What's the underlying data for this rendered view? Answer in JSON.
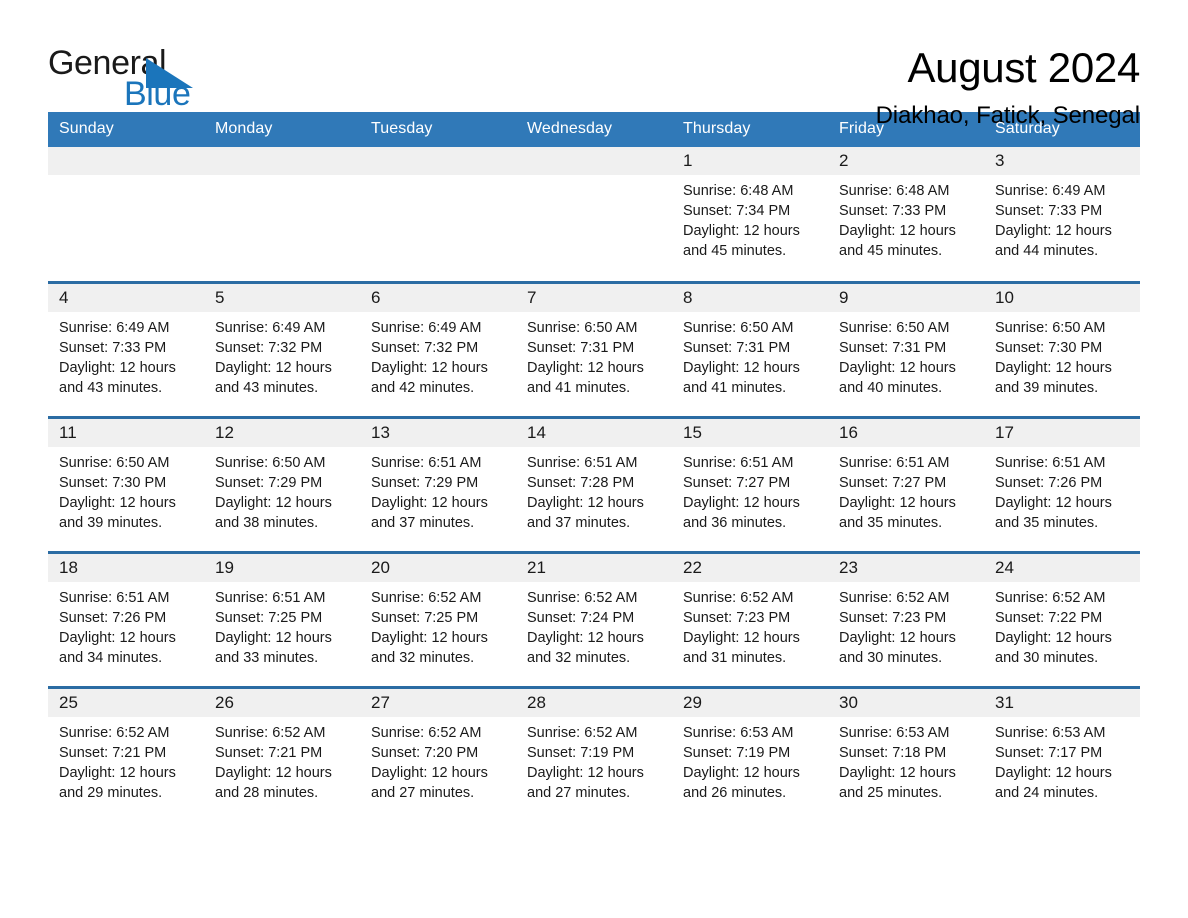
{
  "brand": {
    "name_part1": "General",
    "name_part2": "Blue",
    "triangle_icon": "triangle-icon",
    "accent_color": "#1b75bb"
  },
  "header": {
    "month_title": "August 2024",
    "location": "Diakhao, Fatick, Senegal",
    "header_bg_color": "#3079b8",
    "row_divider_color": "#2b6ca3",
    "daynum_bg_color": "#f0f0f0"
  },
  "weekday_headers": [
    "Sunday",
    "Monday",
    "Tuesday",
    "Wednesday",
    "Thursday",
    "Friday",
    "Saturday"
  ],
  "labels": {
    "sunrise": "Sunrise:",
    "sunset": "Sunset:",
    "daylight": "Daylight:"
  },
  "weeks": [
    [
      {
        "day": "",
        "empty": true
      },
      {
        "day": "",
        "empty": true
      },
      {
        "day": "",
        "empty": true
      },
      {
        "day": "",
        "empty": true
      },
      {
        "day": "1",
        "sunrise": "Sunrise: 6:48 AM",
        "sunset": "Sunset: 7:34 PM",
        "daylight": "Daylight: 12 hours and 45 minutes."
      },
      {
        "day": "2",
        "sunrise": "Sunrise: 6:48 AM",
        "sunset": "Sunset: 7:33 PM",
        "daylight": "Daylight: 12 hours and 45 minutes."
      },
      {
        "day": "3",
        "sunrise": "Sunrise: 6:49 AM",
        "sunset": "Sunset: 7:33 PM",
        "daylight": "Daylight: 12 hours and 44 minutes."
      }
    ],
    [
      {
        "day": "4",
        "sunrise": "Sunrise: 6:49 AM",
        "sunset": "Sunset: 7:33 PM",
        "daylight": "Daylight: 12 hours and 43 minutes."
      },
      {
        "day": "5",
        "sunrise": "Sunrise: 6:49 AM",
        "sunset": "Sunset: 7:32 PM",
        "daylight": "Daylight: 12 hours and 43 minutes."
      },
      {
        "day": "6",
        "sunrise": "Sunrise: 6:49 AM",
        "sunset": "Sunset: 7:32 PM",
        "daylight": "Daylight: 12 hours and 42 minutes."
      },
      {
        "day": "7",
        "sunrise": "Sunrise: 6:50 AM",
        "sunset": "Sunset: 7:31 PM",
        "daylight": "Daylight: 12 hours and 41 minutes."
      },
      {
        "day": "8",
        "sunrise": "Sunrise: 6:50 AM",
        "sunset": "Sunset: 7:31 PM",
        "daylight": "Daylight: 12 hours and 41 minutes."
      },
      {
        "day": "9",
        "sunrise": "Sunrise: 6:50 AM",
        "sunset": "Sunset: 7:31 PM",
        "daylight": "Daylight: 12 hours and 40 minutes."
      },
      {
        "day": "10",
        "sunrise": "Sunrise: 6:50 AM",
        "sunset": "Sunset: 7:30 PM",
        "daylight": "Daylight: 12 hours and 39 minutes."
      }
    ],
    [
      {
        "day": "11",
        "sunrise": "Sunrise: 6:50 AM",
        "sunset": "Sunset: 7:30 PM",
        "daylight": "Daylight: 12 hours and 39 minutes."
      },
      {
        "day": "12",
        "sunrise": "Sunrise: 6:50 AM",
        "sunset": "Sunset: 7:29 PM",
        "daylight": "Daylight: 12 hours and 38 minutes."
      },
      {
        "day": "13",
        "sunrise": "Sunrise: 6:51 AM",
        "sunset": "Sunset: 7:29 PM",
        "daylight": "Daylight: 12 hours and 37 minutes."
      },
      {
        "day": "14",
        "sunrise": "Sunrise: 6:51 AM",
        "sunset": "Sunset: 7:28 PM",
        "daylight": "Daylight: 12 hours and 37 minutes."
      },
      {
        "day": "15",
        "sunrise": "Sunrise: 6:51 AM",
        "sunset": "Sunset: 7:27 PM",
        "daylight": "Daylight: 12 hours and 36 minutes."
      },
      {
        "day": "16",
        "sunrise": "Sunrise: 6:51 AM",
        "sunset": "Sunset: 7:27 PM",
        "daylight": "Daylight: 12 hours and 35 minutes."
      },
      {
        "day": "17",
        "sunrise": "Sunrise: 6:51 AM",
        "sunset": "Sunset: 7:26 PM",
        "daylight": "Daylight: 12 hours and 35 minutes."
      }
    ],
    [
      {
        "day": "18",
        "sunrise": "Sunrise: 6:51 AM",
        "sunset": "Sunset: 7:26 PM",
        "daylight": "Daylight: 12 hours and 34 minutes."
      },
      {
        "day": "19",
        "sunrise": "Sunrise: 6:51 AM",
        "sunset": "Sunset: 7:25 PM",
        "daylight": "Daylight: 12 hours and 33 minutes."
      },
      {
        "day": "20",
        "sunrise": "Sunrise: 6:52 AM",
        "sunset": "Sunset: 7:25 PM",
        "daylight": "Daylight: 12 hours and 32 minutes."
      },
      {
        "day": "21",
        "sunrise": "Sunrise: 6:52 AM",
        "sunset": "Sunset: 7:24 PM",
        "daylight": "Daylight: 12 hours and 32 minutes."
      },
      {
        "day": "22",
        "sunrise": "Sunrise: 6:52 AM",
        "sunset": "Sunset: 7:23 PM",
        "daylight": "Daylight: 12 hours and 31 minutes."
      },
      {
        "day": "23",
        "sunrise": "Sunrise: 6:52 AM",
        "sunset": "Sunset: 7:23 PM",
        "daylight": "Daylight: 12 hours and 30 minutes."
      },
      {
        "day": "24",
        "sunrise": "Sunrise: 6:52 AM",
        "sunset": "Sunset: 7:22 PM",
        "daylight": "Daylight: 12 hours and 30 minutes."
      }
    ],
    [
      {
        "day": "25",
        "sunrise": "Sunrise: 6:52 AM",
        "sunset": "Sunset: 7:21 PM",
        "daylight": "Daylight: 12 hours and 29 minutes."
      },
      {
        "day": "26",
        "sunrise": "Sunrise: 6:52 AM",
        "sunset": "Sunset: 7:21 PM",
        "daylight": "Daylight: 12 hours and 28 minutes."
      },
      {
        "day": "27",
        "sunrise": "Sunrise: 6:52 AM",
        "sunset": "Sunset: 7:20 PM",
        "daylight": "Daylight: 12 hours and 27 minutes."
      },
      {
        "day": "28",
        "sunrise": "Sunrise: 6:52 AM",
        "sunset": "Sunset: 7:19 PM",
        "daylight": "Daylight: 12 hours and 27 minutes."
      },
      {
        "day": "29",
        "sunrise": "Sunrise: 6:53 AM",
        "sunset": "Sunset: 7:19 PM",
        "daylight": "Daylight: 12 hours and 26 minutes."
      },
      {
        "day": "30",
        "sunrise": "Sunrise: 6:53 AM",
        "sunset": "Sunset: 7:18 PM",
        "daylight": "Daylight: 12 hours and 25 minutes."
      },
      {
        "day": "31",
        "sunrise": "Sunrise: 6:53 AM",
        "sunset": "Sunset: 7:17 PM",
        "daylight": "Daylight: 12 hours and 24 minutes."
      }
    ]
  ]
}
